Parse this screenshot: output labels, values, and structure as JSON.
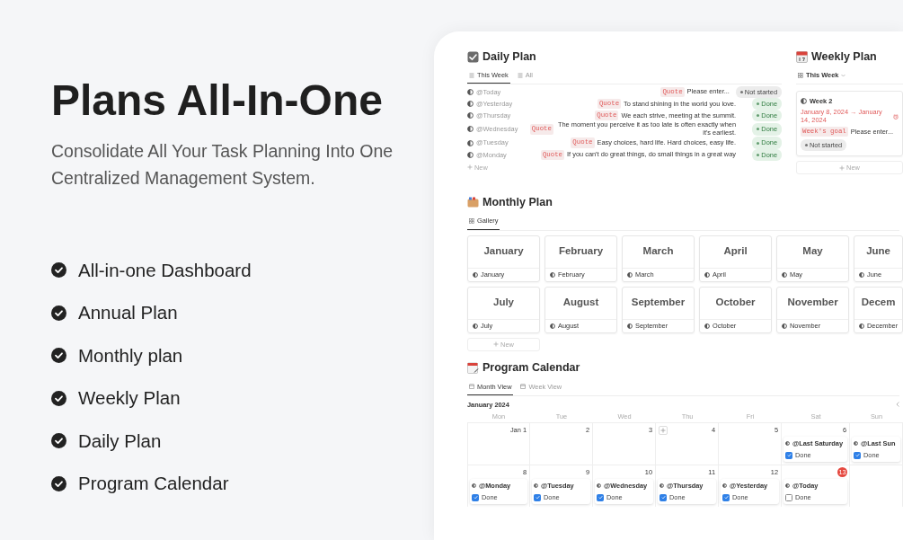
{
  "hero": {
    "title": "Plans All-In-One",
    "subtitle": "Consolidate All Your Task Planning Into One Centralized Management System."
  },
  "features": [
    {
      "label": "All-in-one Dashboard"
    },
    {
      "label": "Annual Plan"
    },
    {
      "label": "Monthly plan"
    },
    {
      "label": "Weekly Plan"
    },
    {
      "label": "Daily Plan"
    },
    {
      "label": "Program Calendar"
    }
  ],
  "daily_plan": {
    "title": "Daily Plan",
    "tabs": [
      {
        "label": "This Week",
        "selected": true
      },
      {
        "label": "All",
        "selected": false
      }
    ],
    "rows": [
      {
        "name": "@Today",
        "tag": "Quote",
        "quote": "Please enter...",
        "status": {
          "label": "Not started",
          "kind": "not_started"
        }
      },
      {
        "name": "@Yesterday",
        "tag": "Quote",
        "quote": "To stand shining in the world you love.",
        "status": {
          "label": "Done",
          "kind": "done"
        }
      },
      {
        "name": "@Thursday",
        "tag": "Quote",
        "quote": "We each strive, meeting at the summit.",
        "status": {
          "label": "Done",
          "kind": "done"
        }
      },
      {
        "name": "@Wednesday",
        "tag": "Quote",
        "quote": "The moment you perceive it as too late is often exactly when it's earliest.",
        "status": {
          "label": "Done",
          "kind": "done"
        }
      },
      {
        "name": "@Tuesday",
        "tag": "Quote",
        "quote": "Easy choices, hard life. Hard choices, easy life.",
        "status": {
          "label": "Done",
          "kind": "done"
        }
      },
      {
        "name": "@Monday",
        "tag": "Quote",
        "quote": "If you can't do great things, do small things in a great way",
        "status": {
          "label": "Done",
          "kind": "done"
        }
      }
    ],
    "new_label": "New"
  },
  "weekly_plan": {
    "title": "Weekly Plan",
    "view": "This Week",
    "card": {
      "title": "Week 2",
      "dates": "January 8, 2024 → January 14, 2024",
      "goal_tag": "Week's goal",
      "goal_text": "Please enter...",
      "status": {
        "label": "Not started",
        "kind": "not_started"
      }
    },
    "new_label": "New"
  },
  "monthly_plan": {
    "title": "Monthly Plan",
    "tabs": [
      {
        "label": "Gallery",
        "selected": true
      }
    ],
    "cards": [
      {
        "title": "January",
        "label": "January"
      },
      {
        "title": "February",
        "label": "February"
      },
      {
        "title": "March",
        "label": "March"
      },
      {
        "title": "April",
        "label": "April"
      },
      {
        "title": "May",
        "label": "May"
      },
      {
        "title": "June",
        "label": "June"
      },
      {
        "title": "July",
        "label": "July"
      },
      {
        "title": "August",
        "label": "August"
      },
      {
        "title": "September",
        "label": "September"
      },
      {
        "title": "October",
        "label": "October"
      },
      {
        "title": "November",
        "label": "November"
      },
      {
        "title": "Decem",
        "label": "December"
      }
    ],
    "new_label": "New"
  },
  "calendar": {
    "title": "Program Calendar",
    "tabs": [
      {
        "label": "Month View",
        "selected": true
      },
      {
        "label": "Week View",
        "selected": false
      }
    ],
    "month": "January 2024",
    "weekdays": [
      {
        "label": "Mon"
      },
      {
        "label": "Tue"
      },
      {
        "label": "Wed"
      },
      {
        "label": "Thu"
      },
      {
        "label": "Fri"
      },
      {
        "label": "Sat"
      },
      {
        "label": "Sun"
      }
    ],
    "weeks": [
      [
        {
          "day": "Jan 1",
          "today": false,
          "hovered": false
        },
        {
          "day": "2",
          "today": false,
          "hovered": false
        },
        {
          "day": "3",
          "today": false,
          "hovered": false
        },
        {
          "day": "4",
          "today": false,
          "hovered": true
        },
        {
          "day": "5",
          "today": false,
          "hovered": false
        },
        {
          "day": "6",
          "today": false,
          "hovered": false,
          "events": [
            {
              "title": "@Last Saturday",
              "check_label": "Done",
              "checked": true
            }
          ]
        },
        {
          "hovered": false,
          "events": [
            {
              "title": "@Last Sun",
              "check_label": "Done",
              "checked": true
            }
          ]
        }
      ],
      [
        {
          "day": "8",
          "today": false,
          "hovered": false,
          "events": [
            {
              "title": "@Monday",
              "check_label": "Done",
              "checked": true
            }
          ]
        },
        {
          "day": "9",
          "today": false,
          "hovered": false,
          "events": [
            {
              "title": "@Tuesday",
              "check_label": "Done",
              "checked": true
            }
          ]
        },
        {
          "day": "10",
          "today": false,
          "hovered": false,
          "events": [
            {
              "title": "@Wednesday",
              "check_label": "Done",
              "checked": true
            }
          ]
        },
        {
          "day": "11",
          "today": false,
          "hovered": false,
          "events": [
            {
              "title": "@Thursday",
              "check_label": "Done",
              "checked": true
            }
          ]
        },
        {
          "day": "12",
          "today": false,
          "hovered": false,
          "events": [
            {
              "title": "@Yesterday",
              "check_label": "Done",
              "checked": true
            }
          ]
        },
        {
          "day": "13",
          "today": true,
          "hovered": false,
          "events": [
            {
              "title": "@Today",
              "check_label": "Done",
              "checked": false
            }
          ]
        },
        {
          "hovered": false
        }
      ]
    ]
  }
}
